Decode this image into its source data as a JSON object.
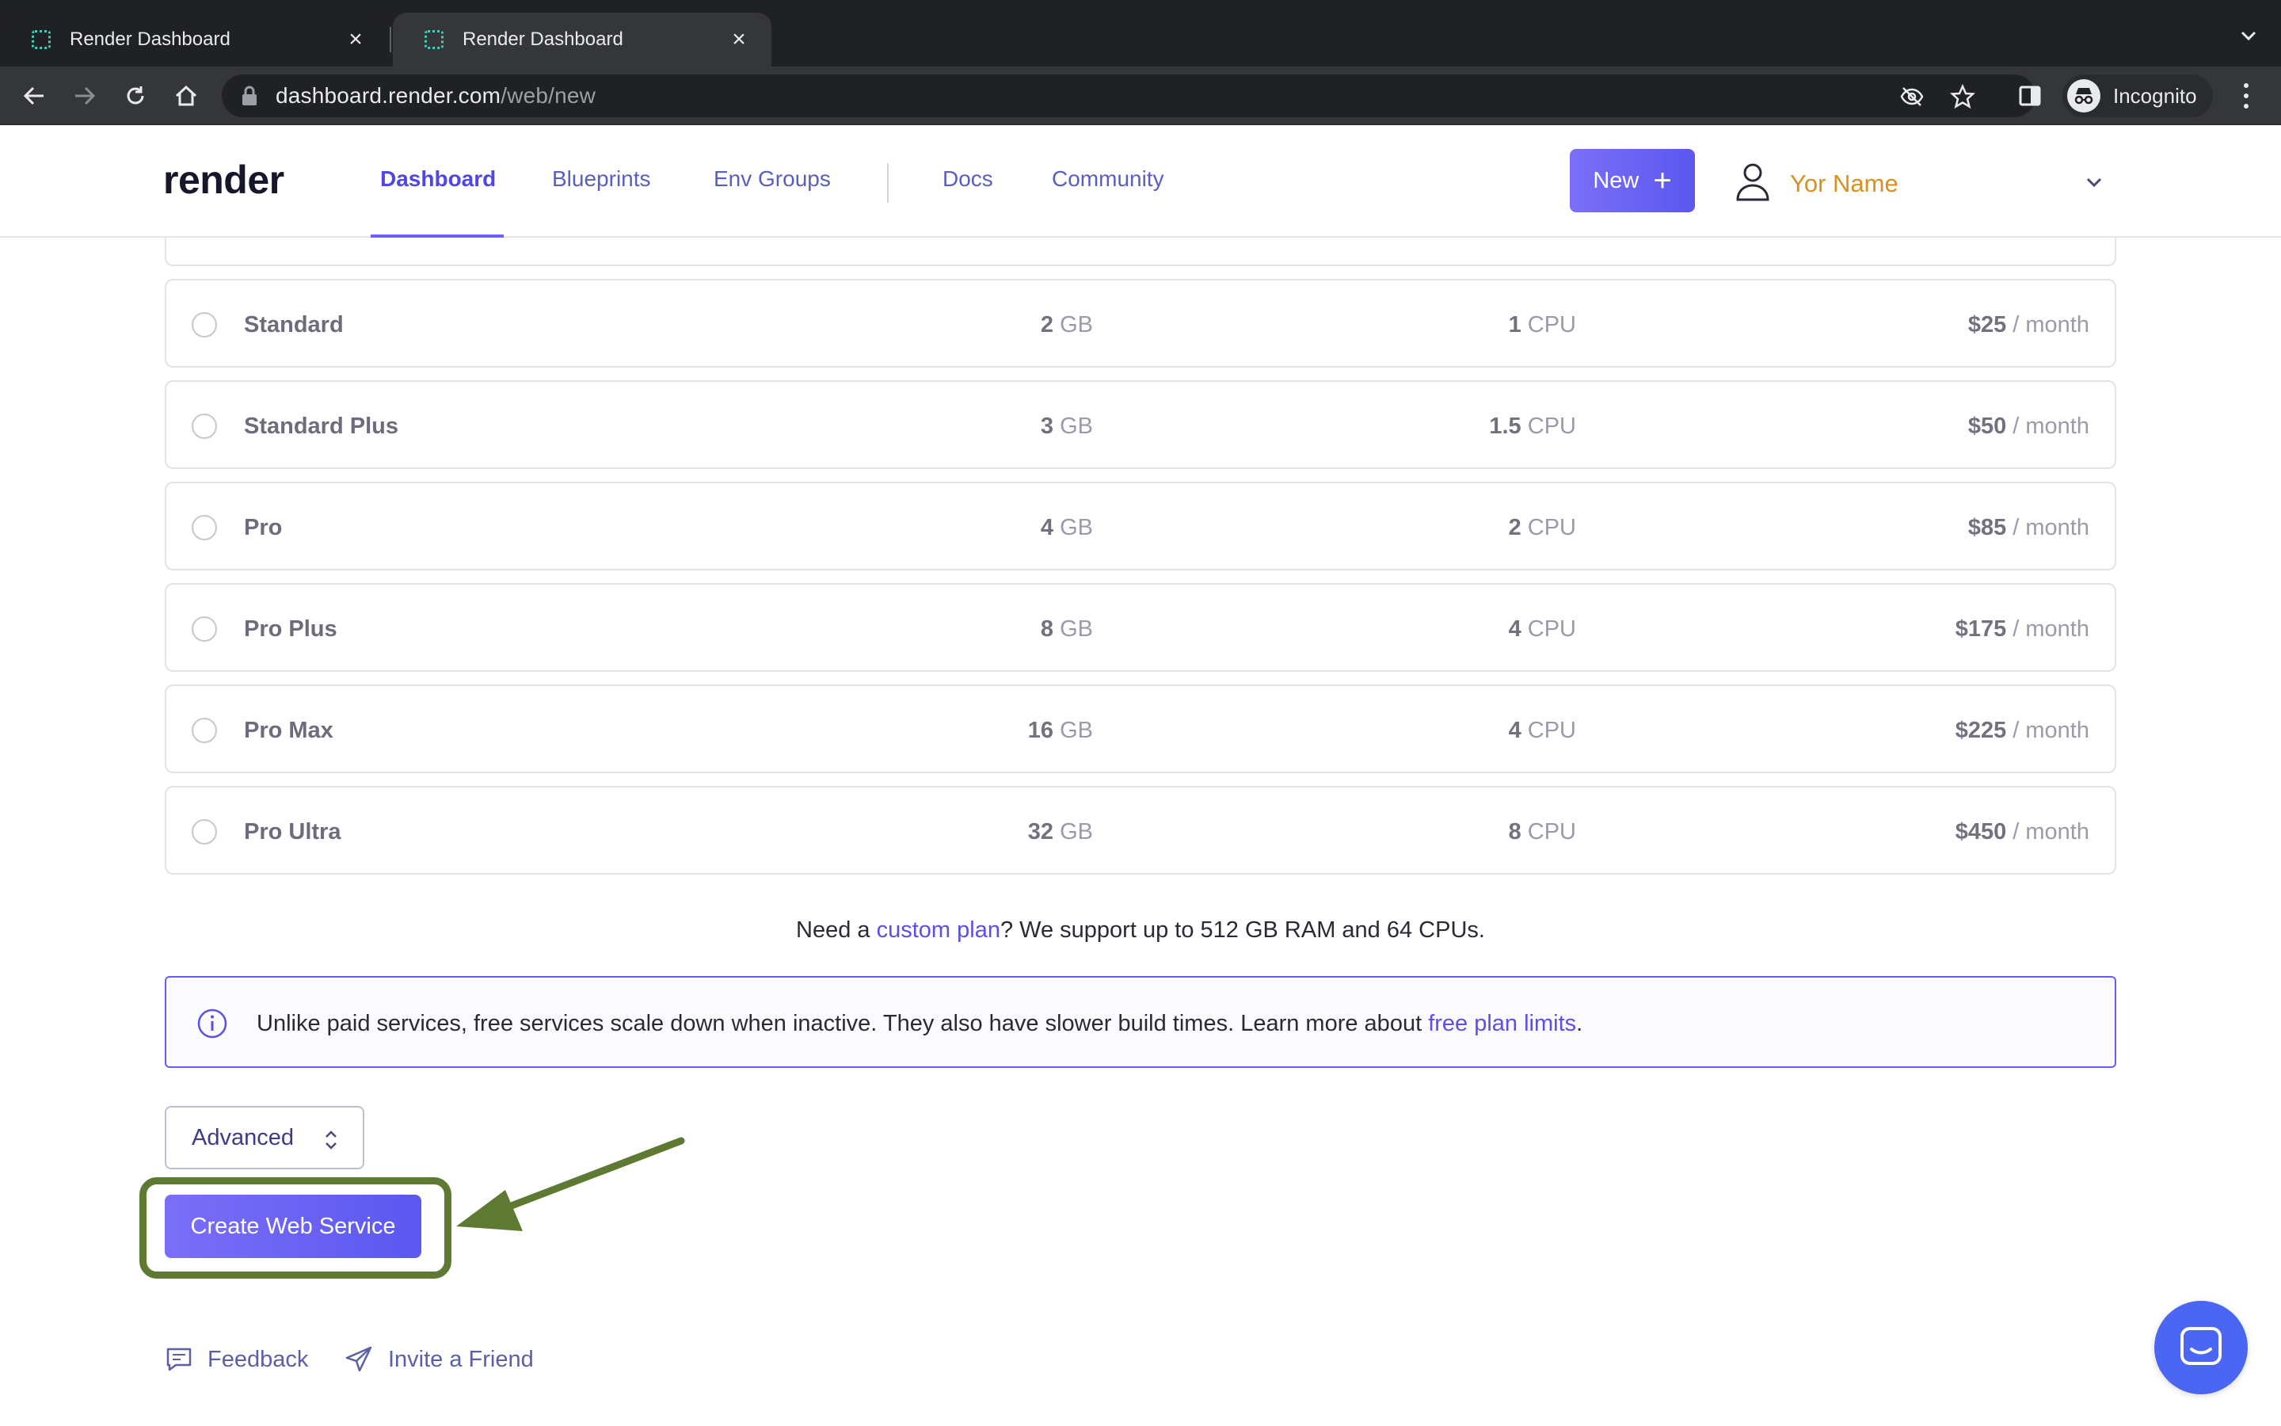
{
  "browser": {
    "tabs": [
      {
        "title": "Render Dashboard",
        "active": false
      },
      {
        "title": "Render Dashboard",
        "active": true
      }
    ],
    "url_host": "dashboard.render.com",
    "url_path": "/web/new",
    "profile_label": "Incognito"
  },
  "header": {
    "logo": "render",
    "nav": {
      "dashboard": "Dashboard",
      "blueprints": "Blueprints",
      "env_groups": "Env Groups",
      "docs": "Docs",
      "community": "Community"
    },
    "new_button": "New",
    "new_button_icon": "plus-icon",
    "user_name": "Yor Name"
  },
  "plans": [
    {
      "name": "Standard",
      "ram": "2",
      "ram_unit": " GB",
      "cpu": "1",
      "cpu_unit": " CPU",
      "price": "$25",
      "period": " / month"
    },
    {
      "name": "Standard Plus",
      "ram": "3",
      "ram_unit": " GB",
      "cpu": "1.5",
      "cpu_unit": " CPU",
      "price": "$50",
      "period": " / month"
    },
    {
      "name": "Pro",
      "ram": "4",
      "ram_unit": " GB",
      "cpu": "2",
      "cpu_unit": " CPU",
      "price": "$85",
      "period": " / month"
    },
    {
      "name": "Pro Plus",
      "ram": "8",
      "ram_unit": " GB",
      "cpu": "4",
      "cpu_unit": " CPU",
      "price": "$175",
      "period": " / month"
    },
    {
      "name": "Pro Max",
      "ram": "16",
      "ram_unit": " GB",
      "cpu": "4",
      "cpu_unit": " CPU",
      "price": "$225",
      "period": " / month"
    },
    {
      "name": "Pro Ultra",
      "ram": "32",
      "ram_unit": " GB",
      "cpu": "8",
      "cpu_unit": " CPU",
      "price": "$450",
      "period": " / month"
    }
  ],
  "custom_plan": {
    "before": "Need a ",
    "link": "custom plan",
    "after": "? We support up to 512 GB RAM and 64 CPUs."
  },
  "info": {
    "text": "Unlike paid services, free services scale down when inactive. They also have slower build times. Learn more about ",
    "link": "free plan limits",
    "end": "."
  },
  "advanced_label": "Advanced",
  "create_button": "Create Web Service",
  "annotation": {
    "highlight_color": "#5e7a32"
  },
  "footer": {
    "feedback": "Feedback",
    "invite": "Invite a Friend"
  },
  "colors": {
    "accent": "#5b57f0",
    "user_name": "#d89020",
    "chat": "#4a66f2"
  }
}
